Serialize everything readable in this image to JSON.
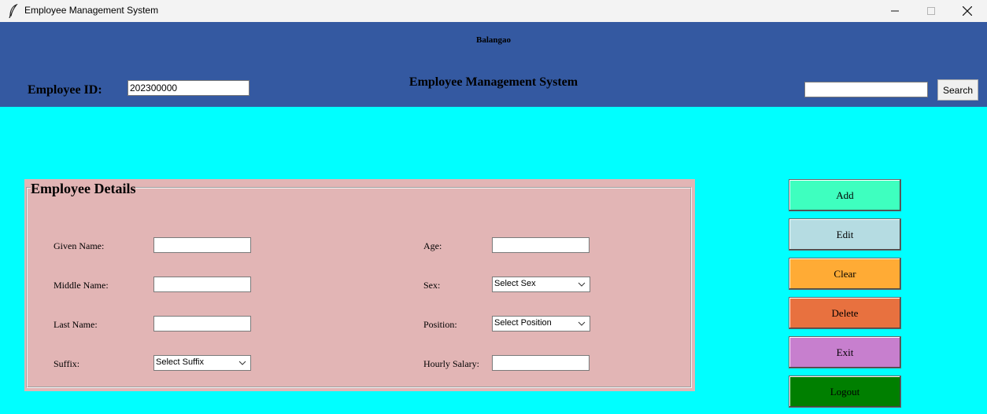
{
  "window": {
    "title": "Employee Management System",
    "minimize_icon": "minimize-icon",
    "maximize_icon": "maximize-icon",
    "close_icon": "close-icon"
  },
  "header": {
    "org": "Balangao",
    "system_title": "Employee Management System",
    "employee_id_label": "Employee ID:",
    "employee_id_value": "202300000",
    "search_value": "",
    "search_button": "Search"
  },
  "details": {
    "legend": "Employee Details",
    "given_name": {
      "label": "Given Name:",
      "value": ""
    },
    "middle_name": {
      "label": "Middle Name:",
      "value": ""
    },
    "last_name": {
      "label": "Last Name:",
      "value": ""
    },
    "suffix": {
      "label": "Suffix:",
      "value": "Select Suffix"
    },
    "age": {
      "label": "Age:",
      "value": ""
    },
    "sex": {
      "label": "Sex:",
      "value": "Select Sex"
    },
    "position": {
      "label": "Position:",
      "value": "Select Position"
    },
    "hourly_salary": {
      "label": "Hourly Salary:",
      "value": ""
    }
  },
  "actions": {
    "add": "Add",
    "edit": "Edit",
    "clear": "Clear",
    "delete": "Delete",
    "exit": "Exit",
    "logout": "Logout"
  },
  "colors": {
    "background": "#00ffff",
    "header": "#3459a1",
    "details_panel": "#e2b5b5",
    "add": "#3effbf",
    "edit": "#b5dce2",
    "clear": "#ffab35",
    "delete": "#e8713f",
    "exit": "#c77fce",
    "logout": "#007f00"
  }
}
